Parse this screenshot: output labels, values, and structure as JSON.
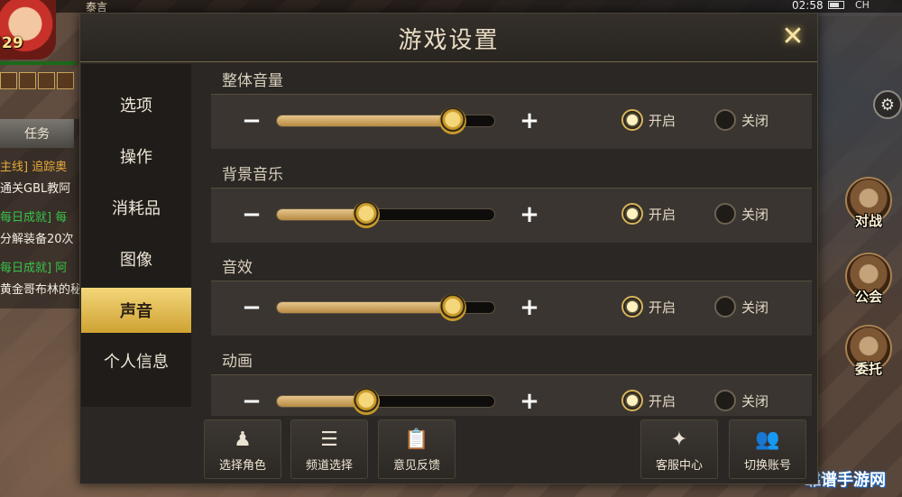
{
  "hud": {
    "player_name": "泰言",
    "level": "29",
    "clock": "02:58",
    "carrier": "CH",
    "watermark": "靠谱手游网"
  },
  "tasks": {
    "tab_label": "任务",
    "lines": [
      {
        "text": "主线] 追踪奥",
        "style": "head"
      },
      {
        "text": "通关GBL教阿",
        "style": "body"
      },
      {
        "text": "每日成就] 每",
        "style": "green"
      },
      {
        "text": "分解装备20次",
        "style": "body"
      },
      {
        "text": "每日成就] 阿",
        "style": "green"
      },
      {
        "text": "黄金哥布林的秘",
        "style": "body"
      }
    ]
  },
  "side_buttons": [
    {
      "label": "对战",
      "icon": "crossed-swords-icon"
    },
    {
      "label": "公会",
      "icon": "guild-crest-icon"
    },
    {
      "label": "委托",
      "icon": "commission-icon"
    }
  ],
  "dialog": {
    "title": "游戏设置",
    "close_icon": "close-icon",
    "nav": [
      {
        "label": "选项",
        "active": false
      },
      {
        "label": "操作",
        "active": false
      },
      {
        "label": "消耗品",
        "active": false
      },
      {
        "label": "图像",
        "active": false
      },
      {
        "label": "声音",
        "active": true
      },
      {
        "label": "个人信息",
        "active": false
      }
    ],
    "sections": [
      {
        "label": "整体音量",
        "level": 0.81,
        "on_label": "开启",
        "off_label": "关闭",
        "enabled": true
      },
      {
        "label": "背景音乐",
        "level": 0.41,
        "on_label": "开启",
        "off_label": "关闭",
        "enabled": true
      },
      {
        "label": "音效",
        "level": 0.81,
        "on_label": "开启",
        "off_label": "关闭",
        "enabled": true
      },
      {
        "label": "动画",
        "level": 0.41,
        "on_label": "开启",
        "off_label": "关闭",
        "enabled": true
      }
    ],
    "minus_symbol": "−",
    "plus_symbol": "+",
    "bottom_buttons": [
      {
        "label": "选择角色",
        "icon": "character-select-icon",
        "glyph": "♟"
      },
      {
        "label": "频道选择",
        "icon": "channel-list-icon",
        "glyph": "☰"
      },
      {
        "label": "意见反馈",
        "icon": "feedback-clipboard-icon",
        "glyph": "📋"
      },
      {
        "label": "客服中心",
        "icon": "customer-service-icon",
        "glyph": "✦"
      },
      {
        "label": "切换账号",
        "icon": "switch-account-icon",
        "glyph": "👥"
      }
    ]
  },
  "colors": {
    "accent_gold": "#cfa232",
    "slider_fill": "#d6b272",
    "panel_bg": "#2a2724"
  }
}
